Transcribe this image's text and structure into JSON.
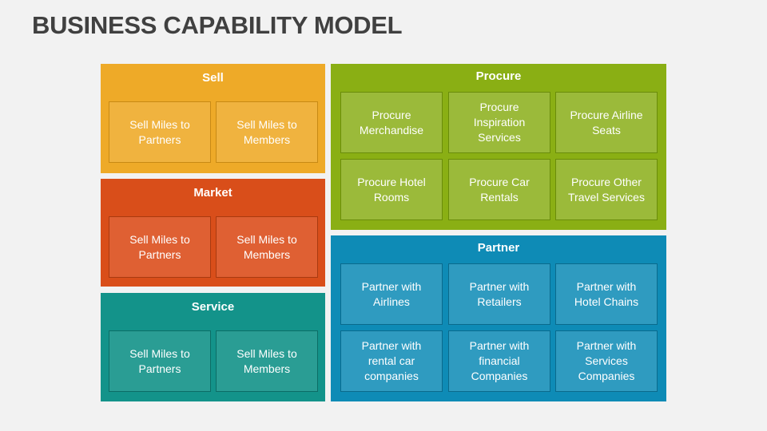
{
  "title": "BUSINESS CAPABILITY MODEL",
  "colors": {
    "sell": "#eeaa28",
    "market": "#d94e1a",
    "service": "#13938a",
    "procure": "#8aaf14",
    "partner": "#0e8bb6",
    "title_text": "#404040",
    "background": "#f2f2f2"
  },
  "panels": {
    "sell": {
      "title": "Sell",
      "items": [
        "Sell Miles to\nPartners",
        "Sell Miles to\nMembers"
      ]
    },
    "market": {
      "title": "Market",
      "items": [
        "Sell Miles to\nPartners",
        "Sell Miles to\nMembers"
      ]
    },
    "service": {
      "title": "Service",
      "items": [
        "Sell Miles to\nPartners",
        "Sell Miles to\nMembers"
      ]
    },
    "procure": {
      "title": "Procure",
      "items": [
        "Procure\nMerchandise",
        "Procure\nInspiration\nServices",
        "Procure Airline\nSeats",
        "Procure Hotel\nRooms",
        "Procure Car\nRentals",
        "Procure Other\nTravel Services"
      ]
    },
    "partner": {
      "title": "Partner",
      "items": [
        "Partner with\nAirlines",
        "Partner with\nRetailers",
        "Partner with\nHotel Chains",
        "Partner with\nrental car\ncompanies",
        "Partner with\nfinancial\nCompanies",
        "Partner with\nServices\nCompanies"
      ]
    }
  }
}
